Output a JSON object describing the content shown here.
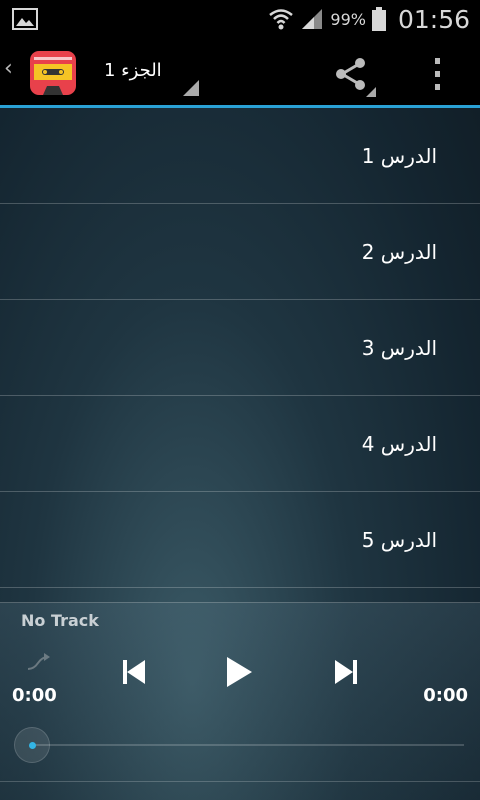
{
  "status_bar": {
    "battery_percent": "99%",
    "time": "01:56"
  },
  "action_bar": {
    "title": "الجزء 1"
  },
  "lessons": [
    {
      "label": "الدرس 1"
    },
    {
      "label": "الدرس 2"
    },
    {
      "label": "الدرس 3"
    },
    {
      "label": "الدرس 4"
    },
    {
      "label": "الدرس 5"
    }
  ],
  "player": {
    "track_name": "No Track",
    "elapsed": "0:00",
    "duration": "0:00",
    "progress_fraction": 0
  },
  "colors": {
    "accent": "#2aa1d5",
    "seek_dot": "#33b5e5",
    "app_icon_red": "#e8414b",
    "app_icon_yellow": "#f5c425"
  }
}
